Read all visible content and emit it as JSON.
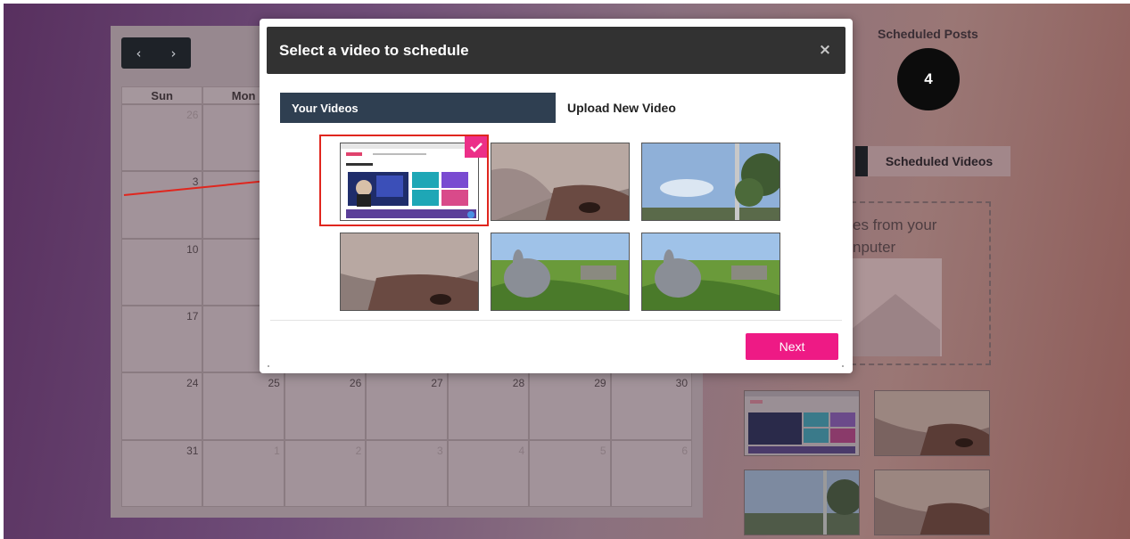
{
  "calendar": {
    "nav_prev": "‹",
    "nav_next": "›",
    "weekdays": [
      "Sun",
      "Mon",
      "",
      "",
      "",
      "",
      ""
    ],
    "weeks": [
      [
        {
          "d": "26",
          "o": true
        },
        {
          "d": "",
          "o": false
        },
        {
          "d": "",
          "o": false
        },
        {
          "d": "",
          "o": false
        },
        {
          "d": "",
          "o": false
        },
        {
          "d": "",
          "o": false
        },
        {
          "d": "",
          "o": false
        }
      ],
      [
        {
          "d": "3",
          "o": false
        },
        {
          "d": "",
          "o": false
        },
        {
          "d": "",
          "o": false
        },
        {
          "d": "",
          "o": false
        },
        {
          "d": "",
          "o": false
        },
        {
          "d": "",
          "o": false
        },
        {
          "d": "",
          "o": false
        }
      ],
      [
        {
          "d": "10",
          "o": false
        },
        {
          "d": "",
          "o": false
        },
        {
          "d": "",
          "o": false
        },
        {
          "d": "",
          "o": false
        },
        {
          "d": "",
          "o": false
        },
        {
          "d": "",
          "o": false
        },
        {
          "d": "",
          "o": false
        }
      ],
      [
        {
          "d": "17",
          "o": false
        },
        {
          "d": "",
          "o": false
        },
        {
          "d": "",
          "o": false
        },
        {
          "d": "",
          "o": false
        },
        {
          "d": "",
          "o": false
        },
        {
          "d": "",
          "o": false
        },
        {
          "d": "",
          "o": false
        }
      ],
      [
        {
          "d": "24",
          "o": false
        },
        {
          "d": "25",
          "o": false
        },
        {
          "d": "26",
          "o": false
        },
        {
          "d": "27",
          "o": false
        },
        {
          "d": "28",
          "o": false
        },
        {
          "d": "29",
          "o": false
        },
        {
          "d": "30",
          "o": false
        }
      ],
      [
        {
          "d": "31",
          "o": false
        },
        {
          "d": "1",
          "o": true
        },
        {
          "d": "2",
          "o": true
        },
        {
          "d": "3",
          "o": true
        },
        {
          "d": "4",
          "o": true
        },
        {
          "d": "5",
          "o": true
        },
        {
          "d": "6",
          "o": true
        }
      ]
    ]
  },
  "sidebar": {
    "scheduled_posts_label": "Scheduled Posts",
    "scheduled_posts_count": "4",
    "scheduled_videos_tab": "Scheduled Videos",
    "drop_text_line1": "es from your",
    "drop_text_line2": "nputer"
  },
  "modal": {
    "title": "Select a video to schedule",
    "close_glyph": "×",
    "tab_your_videos": "Your Videos",
    "tab_upload": "Upload New Video",
    "next_label": "Next",
    "selected_index": 0
  },
  "colors": {
    "accent_pink": "#ee1a85",
    "tab_active_bg": "#2f3f51",
    "header_bg": "#323232",
    "selection_border": "#e0261e"
  }
}
